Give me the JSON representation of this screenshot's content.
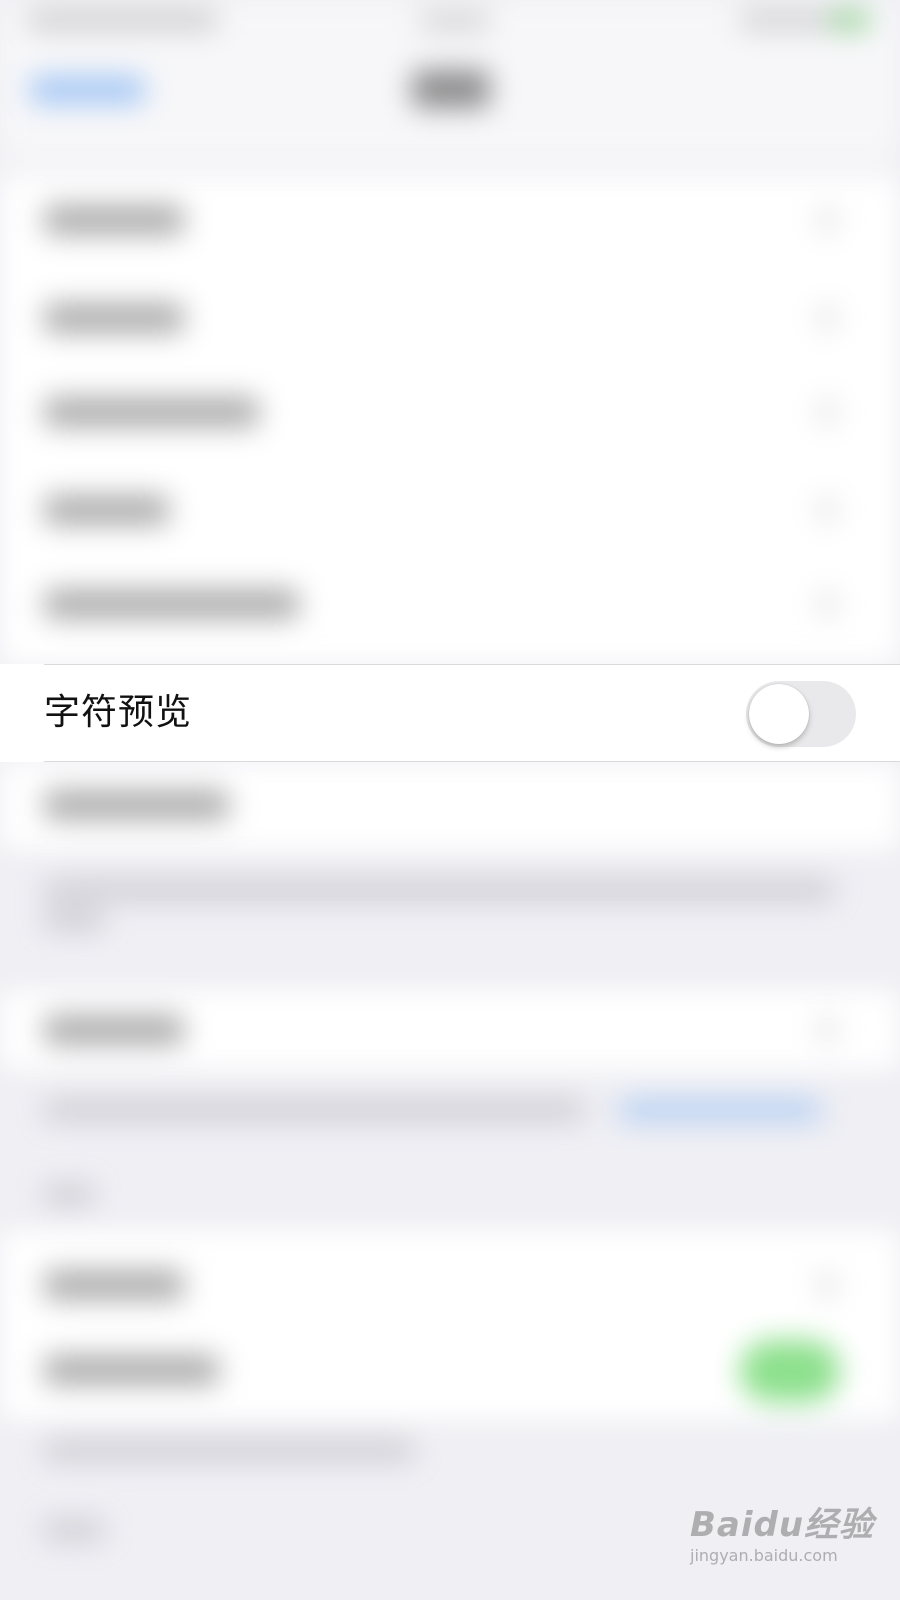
{
  "setting": {
    "label": "字符预览",
    "enabled": false
  },
  "colors": {
    "toggle_off_track": "#e9e9eb",
    "toggle_knob": "#ffffff",
    "accent_blue": "#3d8cf0",
    "toggle_on_green": "#5cd35c",
    "group_background": "#efeff4"
  },
  "watermark": {
    "brand": "Baidu经验",
    "url": "jingyan.baidu.com"
  }
}
